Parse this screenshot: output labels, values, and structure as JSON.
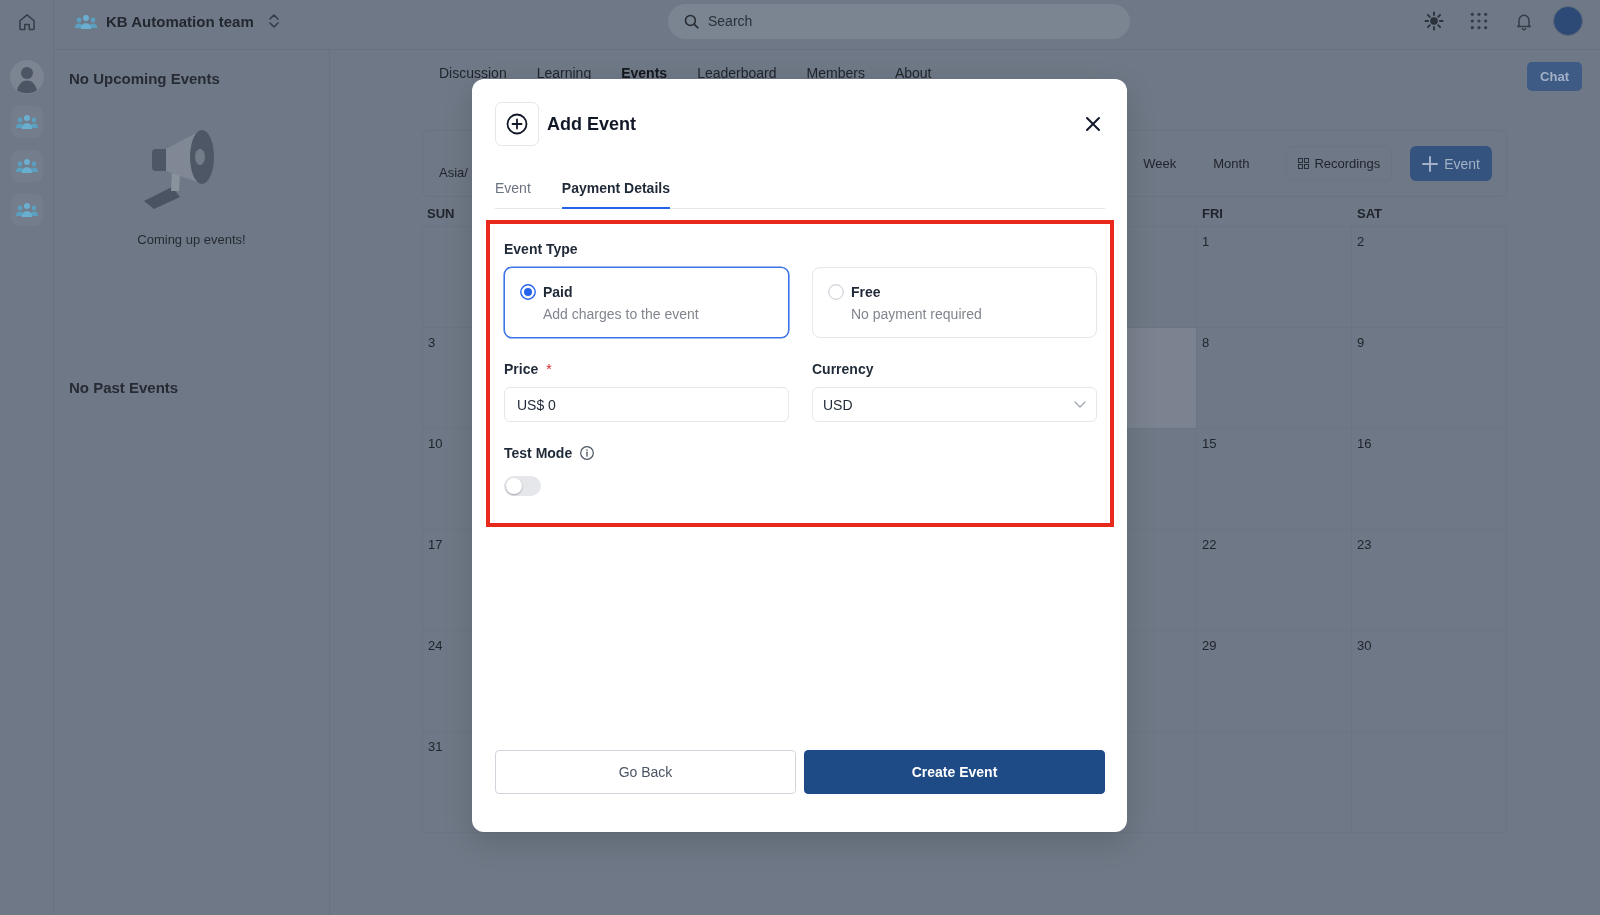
{
  "rail": {
    "items": [
      {
        "kind": "photo"
      },
      {
        "kind": "group"
      },
      {
        "kind": "group"
      },
      {
        "kind": "group"
      }
    ]
  },
  "top_bar": {
    "team_name": "KB Automation team",
    "search": {
      "placeholder": "Search"
    }
  },
  "events_panel": {
    "upcoming_title": "No Upcoming Events",
    "empty_message": "Coming up events!",
    "past_title": "No Past Events"
  },
  "nav_tabs": [
    {
      "label": "Discussion",
      "selected": false
    },
    {
      "label": "Learning",
      "selected": false
    },
    {
      "label": "Events",
      "selected": true
    },
    {
      "label": "Leaderboard",
      "selected": false
    },
    {
      "label": "Members",
      "selected": false
    },
    {
      "label": "About",
      "selected": false
    }
  ],
  "chat_button": "Chat",
  "calendar": {
    "timezone": "Asia/",
    "views": [
      {
        "label": "Week",
        "selected": false
      },
      {
        "label": "Month",
        "selected": false
      }
    ],
    "recordings_button": "Recordings",
    "add_button": "Event",
    "headers": {
      "sun": "SUN",
      "fri": "FRI",
      "sat": "SAT"
    },
    "weeks": [
      {
        "fri": "1",
        "sat": "2",
        "thu_highlighted": false
      },
      {
        "sun": "3",
        "fri": "8",
        "sat": "9",
        "thu_highlighted": true
      },
      {
        "sun": "10",
        "fri": "15",
        "sat": "16",
        "thu_highlighted": false
      },
      {
        "sun": "17",
        "fri": "22",
        "sat": "23",
        "thu_highlighted": false
      },
      {
        "sun": "24",
        "fri": "29",
        "sat": "30",
        "thu_highlighted": false
      },
      {
        "sun": "31",
        "thu_highlighted": false
      }
    ]
  },
  "dialog": {
    "title": "Add Event",
    "tabs": [
      {
        "label": "Event",
        "selected": false
      },
      {
        "label": "Payment Details",
        "selected": true
      }
    ],
    "highlight_frame": true,
    "event_type": {
      "label": "Event Type",
      "options": [
        {
          "title": "Paid",
          "description": "Add charges to the event",
          "selected": true
        },
        {
          "title": "Free",
          "description": "No payment required",
          "selected": false
        }
      ]
    },
    "price": {
      "label": "Price",
      "required_mark": "*",
      "value": "US$ 0"
    },
    "currency": {
      "label": "Currency",
      "value": "USD"
    },
    "test_mode": {
      "label": "Test Mode",
      "on": false
    },
    "buttons": [
      {
        "label": "Go Back",
        "kind": "secondary"
      },
      {
        "label": "Create Event",
        "kind": "primary"
      }
    ]
  }
}
